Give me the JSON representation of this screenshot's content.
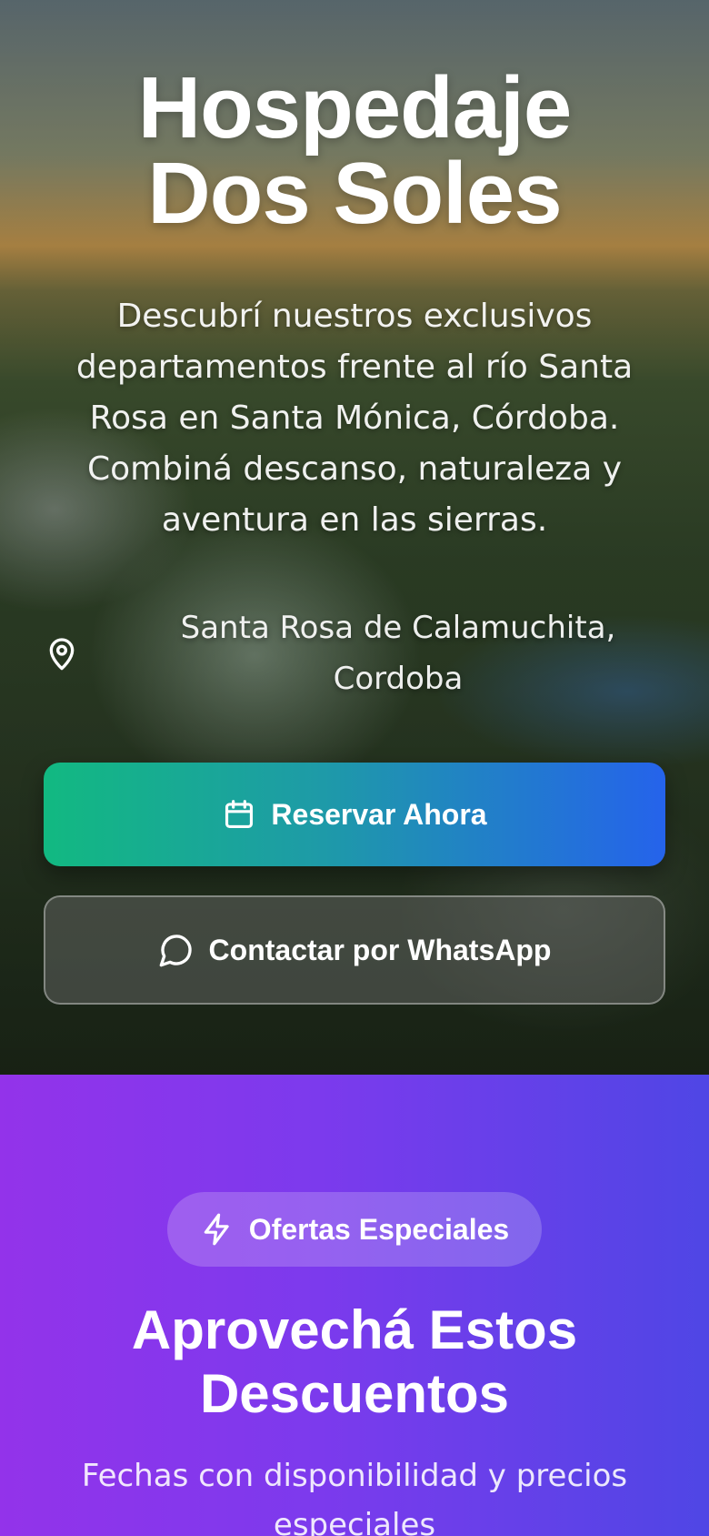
{
  "hero": {
    "title_line1": "Hospedaje",
    "title_line2": "Dos Soles",
    "description": "Descubrí nuestros exclusivos departamentos frente al río Santa Rosa en Santa Mónica, Córdoba. Combiná descanso, naturaleza y aventura en las sierras.",
    "location": {
      "icon": "map-pin-icon",
      "line1": "Santa Rosa de Calamuchita,",
      "line2": "Cordoba"
    },
    "reserve_button": {
      "label": "Reservar Ahora",
      "icon": "calendar-icon"
    },
    "whatsapp_button": {
      "label": "Contactar por WhatsApp",
      "icon": "chat-bubble-icon"
    }
  },
  "offers": {
    "badge": {
      "label": "Ofertas Especiales",
      "icon": "lightning-icon"
    },
    "title_line1": "Aprovechá Estos",
    "title_line2": "Descuentos",
    "subtitle": "Fechas con disponibilidad y precios especiales"
  },
  "colors": {
    "reserve_gradient_start": "#12b981",
    "reserve_gradient_end": "#2563eb",
    "offers_gradient_start": "#9333ea",
    "offers_gradient_end": "#4f46e5"
  }
}
